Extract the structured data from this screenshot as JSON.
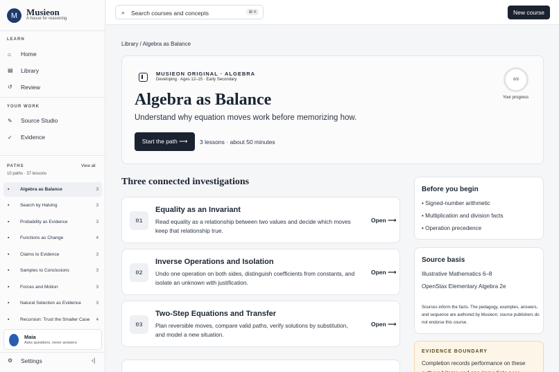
{
  "brand": {
    "name": "Musieon",
    "tagline": "A house for reasoning",
    "logo_icon": "M"
  },
  "sidebar": {
    "learn_label": "LEARN",
    "learn_items": [
      {
        "label": "Home",
        "icon": "home-icon"
      },
      {
        "label": "Library",
        "icon": "library-icon"
      },
      {
        "label": "Review",
        "icon": "review-icon"
      }
    ],
    "work_label": "YOUR WORK",
    "work_items": [
      {
        "label": "Source Studio",
        "icon": "studio-icon"
      },
      {
        "label": "Evidence",
        "icon": "evidence-icon"
      }
    ],
    "paths_label": "PATHS",
    "paths_meta": "10 paths · 37 lessons",
    "view_all": "View all",
    "paths": [
      {
        "label": "Algebra as Balance",
        "count": "3"
      },
      {
        "label": "Search by Halving",
        "count": "3"
      },
      {
        "label": "Probability as Evidence",
        "count": "3"
      },
      {
        "label": "Functions as Change",
        "count": "4"
      },
      {
        "label": "Claims to Evidence",
        "count": "3"
      },
      {
        "label": "Samples to Conclusions",
        "count": "3"
      },
      {
        "label": "Forces and Motion",
        "count": "3"
      },
      {
        "label": "Natural Selection as Evidence",
        "count": "3"
      },
      {
        "label": "Recursion: Trust the Smaller Case",
        "count": "4"
      }
    ],
    "maia": {
      "name": "Maia",
      "sub": "Asks questions, never answers"
    },
    "settings": "Settings",
    "collapse_icon": "‹|"
  },
  "topbar": {
    "search_placeholder": "Search courses and concepts",
    "shortcut": "⌘ K",
    "new_course": "New course"
  },
  "breadcrumb": "Library / Algebra as Balance",
  "hero": {
    "original": "MUSIEON ORIGINAL · ALGEBRA",
    "meta_line": "Developing · Ages 12–15 · Early Secondary",
    "title": "Algebra as Balance",
    "subtitle": "Understand why equation moves work before memorizing how.",
    "start": "Start the path  ⟶",
    "lessons_meta": "3 lessons · about 50 minutes",
    "progress_value": "0/3",
    "progress_label": "Your progress"
  },
  "section_title": "Three connected investigations",
  "investigations": [
    {
      "num": "01",
      "title": "Equality as an Invariant",
      "desc": "Read equality as a relationship between two values and decide which moves keep that relationship true.",
      "open": "Open ⟶"
    },
    {
      "num": "02",
      "title": "Inverse Operations and Isolation",
      "desc": "Undo one operation on both sides, distinguish coefficients from constants, and isolate an unknown with justification.",
      "open": "Open ⟶"
    },
    {
      "num": "03",
      "title": "Two-Step Equations and Transfer",
      "desc": "Plan reversible moves, compare valid paths, verify solutions by substitution, and model a new situation.",
      "open": "Open ⟶"
    }
  ],
  "before": {
    "title": "Before you begin",
    "items": [
      "• Signed-number arithmetic",
      "• Multiplication and division facts",
      "• Operation precedence"
    ]
  },
  "source": {
    "title": "Source basis",
    "items": [
      "Illustrative Mathematics 6–8",
      "OpenStax Elementary Algebra 2e"
    ],
    "note": "Sources inform the facts. The pedagogy, examples, answers, and sequence are authored by Musieon; source publishers do not endorse this course."
  },
  "evidence": {
    "title": "EVIDENCE BOUNDARY",
    "text": "Completion records performance on these authored items and one immediate near"
  }
}
